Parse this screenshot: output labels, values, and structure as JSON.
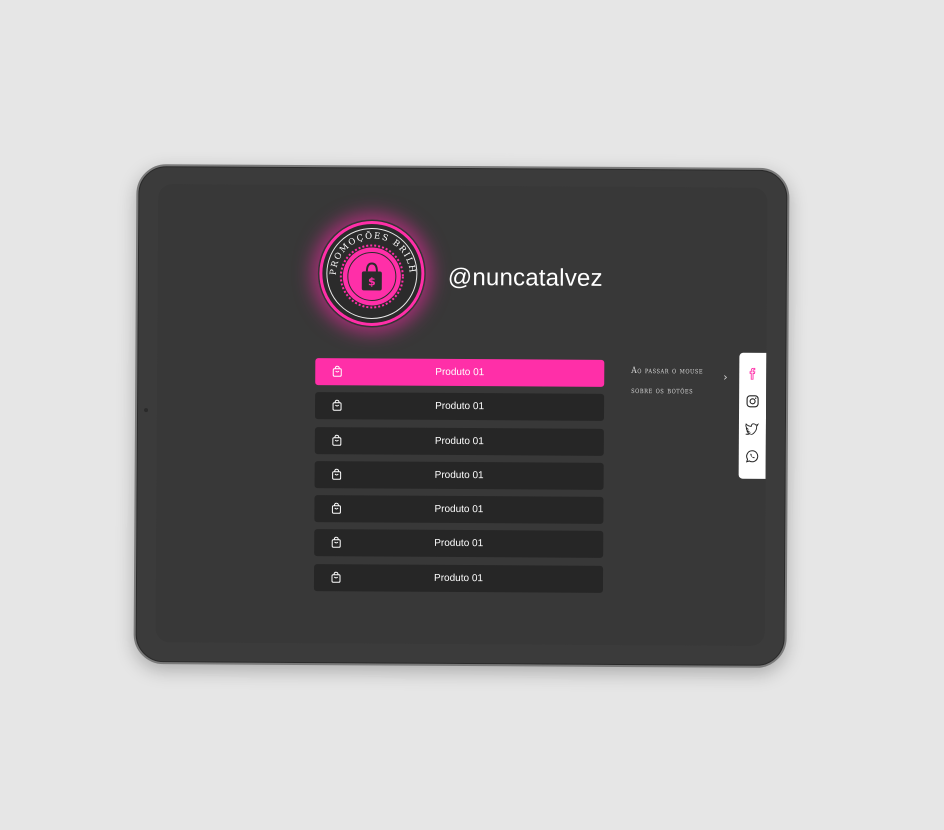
{
  "profile": {
    "logo_text": "PROMOÇÕES BRILHANTE",
    "logo_symbol": "$",
    "handle": "@nuncatalvez"
  },
  "buttons": [
    {
      "label": "Produto 01",
      "active": true
    },
    {
      "label": "Produto 01",
      "active": false
    },
    {
      "label": "Produto 01",
      "active": false
    },
    {
      "label": "Produto 01",
      "active": false
    },
    {
      "label": "Produto 01",
      "active": false
    },
    {
      "label": "Produto 01",
      "active": false
    },
    {
      "label": "Produto 01",
      "active": false
    }
  ],
  "hint": {
    "line1": "Ao passar o mouse",
    "line2": "sobre os botões",
    "arrow": "›"
  },
  "social": [
    "facebook-icon",
    "instagram-icon",
    "twitter-icon",
    "whatsapp-icon"
  ],
  "colors": {
    "accent": "#ff2fa8",
    "button_bg": "#262626",
    "screen_bg": "#383838",
    "page_bg": "#e6e6e6"
  }
}
